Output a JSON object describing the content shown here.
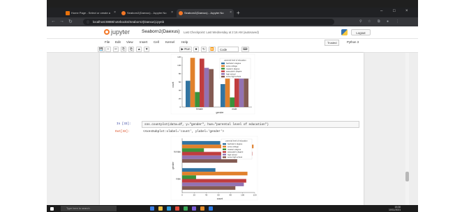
{
  "browser": {
    "tabs": [
      {
        "label": "Home Page - Select or create a",
        "favicon_color": "#e8710a"
      },
      {
        "label": "Seaborn2(Daexus) - Jupyter No",
        "favicon_color": "#f37726"
      },
      {
        "label": "Seaborn2(Daexus) - Jupyter No",
        "favicon_color": "#f37726",
        "active": true
      }
    ],
    "new_tab": "+",
    "url": "localhost:8888/notebooks/Seaborn2(Daexus).ipynb",
    "window_controls": [
      "–",
      "□",
      "×"
    ]
  },
  "jupyter": {
    "logo_text": "jupyter",
    "notebook_name": "Seaborn2(Daexus)",
    "checkpoint": "Last Checkpoint: Last Wednesday at 2:16 AM  (autosaved)",
    "logout": "Logout",
    "menus": [
      "File",
      "Edit",
      "View",
      "Insert",
      "Cell",
      "Kernel",
      "Help"
    ],
    "trusted": "Trusted",
    "kernel": "Python 3",
    "toolbar": {
      "buttons": [
        "💾",
        "+",
        "✂",
        "⎘",
        "⎗",
        "▲",
        "▼"
      ],
      "run": "▶ Run",
      "stop": "■",
      "restart": "↻",
      "fast_forward": "⏩",
      "cell_type": "Code",
      "keyboard": "⌨"
    },
    "cells": {
      "in_prompt": "In [33]:",
      "in_code": "sns.countplot(data=df, y=\"gender\", hue=\"parental level of education\")",
      "out_prompt": "Out[33]:",
      "out_text": "<AxesSubplot:xlabel='count', ylabel='gender'>"
    }
  },
  "chart_data": [
    {
      "type": "bar",
      "categories": [
        "female",
        "male"
      ],
      "xlabel": "gender",
      "ylabel": "count",
      "ylim": [
        0,
        120
      ],
      "yticks": [
        0,
        20,
        40,
        60,
        80,
        100,
        120
      ],
      "legend_title": "parental level of education",
      "legend_placement": "top-right",
      "series": [
        {
          "name": "bachelor's degree",
          "color": "#3274a1",
          "values": [
            63,
            55
          ]
        },
        {
          "name": "some college",
          "color": "#e1812c",
          "values": [
            118,
            108
          ]
        },
        {
          "name": "master's degree",
          "color": "#3a923a",
          "values": [
            36,
            23
          ]
        },
        {
          "name": "associate's degree",
          "color": "#c03d3e",
          "values": [
            116,
            106
          ]
        },
        {
          "name": "high school",
          "color": "#9372b2",
          "values": [
            94,
            102
          ]
        },
        {
          "name": "some high school",
          "color": "#845b53",
          "values": [
            91,
            88
          ]
        }
      ]
    },
    {
      "type": "bar",
      "orientation": "horizontal",
      "categories": [
        "female",
        "male"
      ],
      "xlabel": "count",
      "ylabel": "gender",
      "xlim": [
        0,
        120
      ],
      "xticks": [
        0,
        20,
        40,
        60,
        80,
        100,
        120
      ],
      "legend_title": "parental level of education",
      "legend_placement": "top-right",
      "series": [
        {
          "name": "bachelor's degree",
          "color": "#3274a1",
          "values": [
            63,
            55
          ]
        },
        {
          "name": "some college",
          "color": "#e1812c",
          "values": [
            118,
            108
          ]
        },
        {
          "name": "master's degree",
          "color": "#3a923a",
          "values": [
            36,
            23
          ]
        },
        {
          "name": "associate's degree",
          "color": "#c03d3e",
          "values": [
            116,
            106
          ]
        },
        {
          "name": "high school",
          "color": "#9372b2",
          "values": [
            94,
            102
          ]
        },
        {
          "name": "some high school",
          "color": "#845b53",
          "values": [
            91,
            88
          ]
        }
      ]
    }
  ],
  "taskbar": {
    "search_placeholder": "Type here to search",
    "time": "15:30",
    "date": "10/11/2021",
    "app_colors": [
      "#3b7de0",
      "#f0c040",
      "#2d9cdb",
      "#e04a3a",
      "#3aa757",
      "#7a5cd6",
      "#e08a2a",
      "#2c7be5"
    ]
  }
}
